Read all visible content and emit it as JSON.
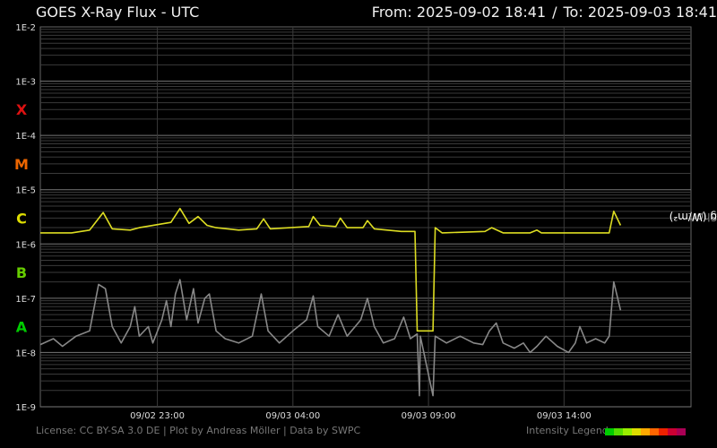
{
  "header": {
    "title": "GOES X-Ray Flux - UTC",
    "from_label": "From:",
    "from": "2025-09-02 18:41",
    "separator": "/",
    "to_label": "To:",
    "to": "2025-09-03 18:41"
  },
  "y_axis_label": {
    "short": "Short",
    "sep": ", ",
    "long": "Long (W/m²)",
    "short_color": "#888888",
    "long_color": "#ffffff"
  },
  "footer": "License: CC BY-SA 3.0 DE | Plot by Andreas Möller | Data by SWPC",
  "legend": {
    "label": "Intensity Legend",
    "colors": [
      "#00cc00",
      "#55dd00",
      "#99ee00",
      "#dddd00",
      "#ffaa00",
      "#ff6600",
      "#ee2200",
      "#cc0033",
      "#aa0055"
    ]
  },
  "chart_data": {
    "type": "line",
    "x_unit": "UTC",
    "x_range": [
      "2025-09-02 18:41",
      "2025-09-03 18:41"
    ],
    "x_ticks": [
      {
        "t": "2025-09-02 23:00",
        "label": "09/02 23:00"
      },
      {
        "t": "2025-09-03 04:00",
        "label": "09/03 04:00"
      },
      {
        "t": "2025-09-03 09:00",
        "label": "09/03 09:00"
      },
      {
        "t": "2025-09-03 14:00",
        "label": "09/03 14:00"
      }
    ],
    "y_scale": "log",
    "ylim": [
      1e-09,
      0.01
    ],
    "y_ticks": [
      {
        "v": 0.01,
        "label": "1E-2"
      },
      {
        "v": 0.001,
        "label": "1E-3"
      },
      {
        "v": 0.0001,
        "label": "1E-4"
      },
      {
        "v": 1e-05,
        "label": "1E-5"
      },
      {
        "v": 1e-06,
        "label": "1E-6"
      },
      {
        "v": 1e-07,
        "label": "1E-7"
      },
      {
        "v": 1e-08,
        "label": "1E-8"
      },
      {
        "v": 1e-09,
        "label": "1E-9"
      }
    ],
    "flare_classes": [
      {
        "label": "X",
        "v": 0.0003,
        "color": "#dd1111"
      },
      {
        "label": "M",
        "v": 3e-05,
        "color": "#ee6600"
      },
      {
        "label": "C",
        "v": 3e-06,
        "color": "#dddd00"
      },
      {
        "label": "B",
        "v": 3e-07,
        "color": "#66cc00"
      },
      {
        "label": "A",
        "v": 3e-08,
        "color": "#00cc00"
      }
    ],
    "grid": true,
    "series": [
      {
        "color": "#dddd22",
        "points": [
          [
            "2025-09-02 18:41",
            1.6e-06
          ],
          [
            "2025-09-02 19:50",
            1.6e-06
          ],
          [
            "2025-09-02 20:30",
            1.8e-06
          ],
          [
            "2025-09-02 21:00",
            3.8e-06
          ],
          [
            "2025-09-02 21:20",
            1.9e-06
          ],
          [
            "2025-09-02 22:00",
            1.8e-06
          ],
          [
            "2025-09-02 22:20",
            2e-06
          ],
          [
            "2025-09-02 23:30",
            2.5e-06
          ],
          [
            "2025-09-02 23:50",
            4.5e-06
          ],
          [
            "2025-09-03 00:10",
            2.4e-06
          ],
          [
            "2025-09-03 00:30",
            3.2e-06
          ],
          [
            "2025-09-03 00:50",
            2.2e-06
          ],
          [
            "2025-09-03 01:10",
            2e-06
          ],
          [
            "2025-09-03 02:00",
            1.8e-06
          ],
          [
            "2025-09-03 02:40",
            1.9e-06
          ],
          [
            "2025-09-03 02:55",
            2.9e-06
          ],
          [
            "2025-09-03 03:10",
            1.9e-06
          ],
          [
            "2025-09-03 04:35",
            2.1e-06
          ],
          [
            "2025-09-03 04:45",
            3.2e-06
          ],
          [
            "2025-09-03 05:00",
            2.2e-06
          ],
          [
            "2025-09-03 05:35",
            2.1e-06
          ],
          [
            "2025-09-03 05:45",
            3e-06
          ],
          [
            "2025-09-03 06:00",
            2e-06
          ],
          [
            "2025-09-03 06:35",
            2e-06
          ],
          [
            "2025-09-03 06:45",
            2.7e-06
          ],
          [
            "2025-09-03 07:00",
            1.9e-06
          ],
          [
            "2025-09-03 08:00",
            1.7e-06
          ],
          [
            "2025-09-03 08:30",
            1.7e-06
          ],
          [
            "2025-09-03 08:35",
            2.5e-08
          ],
          [
            "2025-09-03 09:10",
            2.5e-08
          ],
          [
            "2025-09-03 09:15",
            2e-06
          ],
          [
            "2025-09-03 09:30",
            1.6e-06
          ],
          [
            "2025-09-03 11:05",
            1.7e-06
          ],
          [
            "2025-09-03 11:20",
            2e-06
          ],
          [
            "2025-09-03 11:45",
            1.6e-06
          ],
          [
            "2025-09-03 12:45",
            1.6e-06
          ],
          [
            "2025-09-03 13:00",
            1.8e-06
          ],
          [
            "2025-09-03 13:10",
            1.6e-06
          ],
          [
            "2025-09-03 14:30",
            1.6e-06
          ],
          [
            "2025-09-03 15:40",
            1.6e-06
          ],
          [
            "2025-09-03 15:50",
            4e-06
          ],
          [
            "2025-09-03 16:05",
            2.2e-06
          ]
        ]
      },
      {
        "color": "#888888",
        "points": [
          [
            "2025-09-02 18:41",
            1.4e-08
          ],
          [
            "2025-09-02 19:10",
            1.8e-08
          ],
          [
            "2025-09-02 19:30",
            1.3e-08
          ],
          [
            "2025-09-02 20:00",
            2e-08
          ],
          [
            "2025-09-02 20:30",
            2.5e-08
          ],
          [
            "2025-09-02 20:50",
            1.8e-07
          ],
          [
            "2025-09-02 21:05",
            1.5e-07
          ],
          [
            "2025-09-02 21:20",
            3e-08
          ],
          [
            "2025-09-02 21:40",
            1.5e-08
          ],
          [
            "2025-09-02 22:00",
            3e-08
          ],
          [
            "2025-09-02 22:10",
            7e-08
          ],
          [
            "2025-09-02 22:20",
            2e-08
          ],
          [
            "2025-09-02 22:40",
            3e-08
          ],
          [
            "2025-09-02 22:50",
            1.5e-08
          ],
          [
            "2025-09-02 23:10",
            4e-08
          ],
          [
            "2025-09-02 23:20",
            9e-08
          ],
          [
            "2025-09-02 23:30",
            3e-08
          ],
          [
            "2025-09-02 23:40",
            1.2e-07
          ],
          [
            "2025-09-02 23:50",
            2.2e-07
          ],
          [
            "2025-09-03 00:05",
            4e-08
          ],
          [
            "2025-09-03 00:20",
            1.5e-07
          ],
          [
            "2025-09-03 00:30",
            3.5e-08
          ],
          [
            "2025-09-03 00:45",
            1e-07
          ],
          [
            "2025-09-03 00:55",
            1.2e-07
          ],
          [
            "2025-09-03 01:10",
            2.5e-08
          ],
          [
            "2025-09-03 01:30",
            1.8e-08
          ],
          [
            "2025-09-03 02:00",
            1.5e-08
          ],
          [
            "2025-09-03 02:30",
            2e-08
          ],
          [
            "2025-09-03 02:50",
            1.2e-07
          ],
          [
            "2025-09-03 03:05",
            2.5e-08
          ],
          [
            "2025-09-03 03:30",
            1.5e-08
          ],
          [
            "2025-09-03 04:00",
            2.5e-08
          ],
          [
            "2025-09-03 04:30",
            4e-08
          ],
          [
            "2025-09-03 04:45",
            1.1e-07
          ],
          [
            "2025-09-03 04:55",
            3e-08
          ],
          [
            "2025-09-03 05:20",
            2e-08
          ],
          [
            "2025-09-03 05:40",
            5e-08
          ],
          [
            "2025-09-03 06:00",
            2e-08
          ],
          [
            "2025-09-03 06:30",
            4e-08
          ],
          [
            "2025-09-03 06:45",
            1e-07
          ],
          [
            "2025-09-03 07:00",
            3e-08
          ],
          [
            "2025-09-03 07:20",
            1.5e-08
          ],
          [
            "2025-09-03 07:45",
            1.8e-08
          ],
          [
            "2025-09-03 08:05",
            4.5e-08
          ],
          [
            "2025-09-03 08:20",
            1.8e-08
          ],
          [
            "2025-09-03 08:35",
            2.2e-08
          ],
          [
            "2025-09-03 08:40",
            1.6e-09
          ],
          [
            "2025-09-03 08:42",
            2e-08
          ],
          [
            "2025-09-03 09:10",
            1.6e-09
          ],
          [
            "2025-09-03 09:15",
            2e-08
          ],
          [
            "2025-09-03 09:40",
            1.5e-08
          ],
          [
            "2025-09-03 10:10",
            2e-08
          ],
          [
            "2025-09-03 10:40",
            1.5e-08
          ],
          [
            "2025-09-03 11:00",
            1.4e-08
          ],
          [
            "2025-09-03 11:15",
            2.5e-08
          ],
          [
            "2025-09-03 11:30",
            3.5e-08
          ],
          [
            "2025-09-03 11:45",
            1.5e-08
          ],
          [
            "2025-09-03 12:10",
            1.2e-08
          ],
          [
            "2025-09-03 12:30",
            1.5e-08
          ],
          [
            "2025-09-03 12:45",
            1e-08
          ],
          [
            "2025-09-03 13:00",
            1.3e-08
          ],
          [
            "2025-09-03 13:20",
            2e-08
          ],
          [
            "2025-09-03 13:45",
            1.3e-08
          ],
          [
            "2025-09-03 14:10",
            1e-08
          ],
          [
            "2025-09-03 14:25",
            1.5e-08
          ],
          [
            "2025-09-03 14:35",
            3e-08
          ],
          [
            "2025-09-03 14:50",
            1.5e-08
          ],
          [
            "2025-09-03 15:10",
            1.8e-08
          ],
          [
            "2025-09-03 15:30",
            1.5e-08
          ],
          [
            "2025-09-03 15:40",
            2e-08
          ],
          [
            "2025-09-03 15:50",
            2e-07
          ],
          [
            "2025-09-03 16:05",
            6e-08
          ]
        ]
      }
    ]
  }
}
